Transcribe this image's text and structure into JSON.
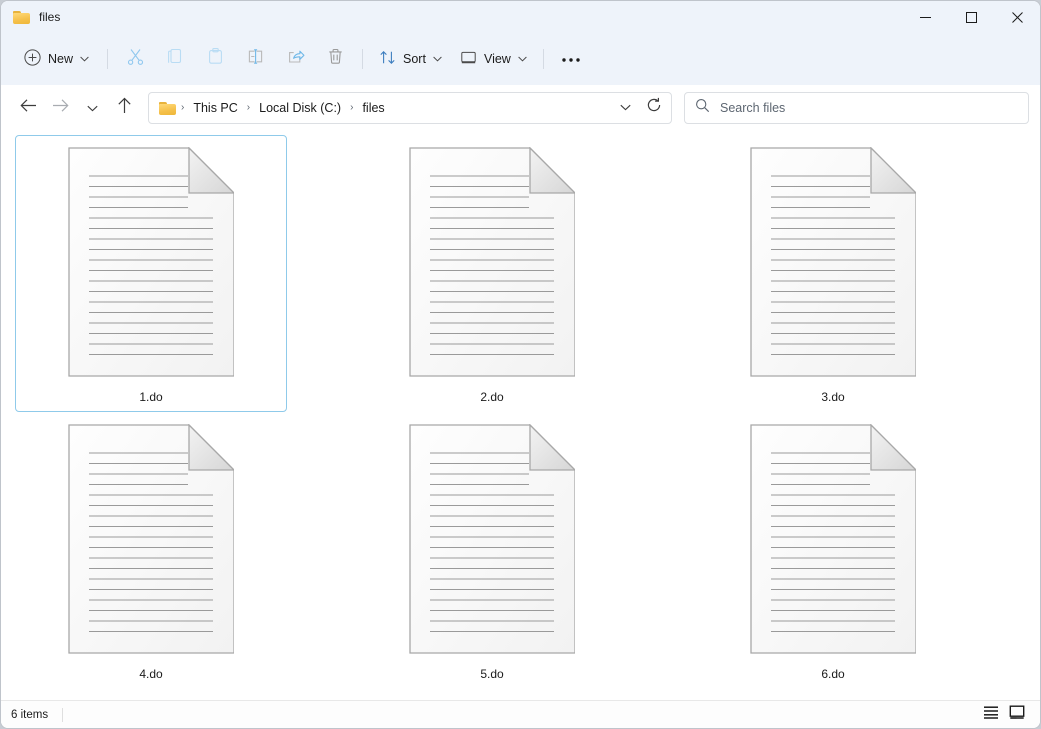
{
  "window": {
    "tab_title": "files",
    "folder_icon": "folder-icon",
    "minimize_label": "Minimize",
    "maximize_label": "Maximize",
    "close_label": "Close"
  },
  "toolbar": {
    "new_label": "New",
    "new_icon": "plus-circle-icon",
    "cut_icon": "scissors-icon",
    "copy_icon": "copy-icon",
    "paste_icon": "paste-icon",
    "rename_icon": "rename-icon",
    "share_icon": "share-icon",
    "delete_icon": "trash-icon",
    "sort_label": "Sort",
    "sort_icon": "sort-arrows-icon",
    "view_label": "View",
    "view_icon": "monitor-icon",
    "more_label": "See more",
    "more_icon": "ellipsis-icon",
    "chevron": "⌄"
  },
  "nav": {
    "back_icon": "back-arrow-icon",
    "forward_icon": "forward-arrow-icon",
    "recent_icon": "chevron-down-icon",
    "up_icon": "up-arrow-icon",
    "address_chevron_icon": "chevron-down-icon",
    "refresh_icon": "refresh-icon",
    "breadcrumb_icon": "folder-icon",
    "breadcrumbs": [
      {
        "label": "This PC"
      },
      {
        "label": "Local Disk (C:)"
      },
      {
        "label": "files"
      }
    ],
    "separator": "›"
  },
  "search": {
    "placeholder": "Search files",
    "icon": "search-icon"
  },
  "files": [
    {
      "name": "1.do",
      "icon": "document-icon",
      "selected": true
    },
    {
      "name": "2.do",
      "icon": "document-icon",
      "selected": false
    },
    {
      "name": "3.do",
      "icon": "document-icon",
      "selected": false
    },
    {
      "name": "4.do",
      "icon": "document-icon",
      "selected": false
    },
    {
      "name": "5.do",
      "icon": "document-icon",
      "selected": false
    },
    {
      "name": "6.do",
      "icon": "document-icon",
      "selected": false
    }
  ],
  "statusbar": {
    "item_count": "6 items",
    "details_view_icon": "details-view-icon",
    "large_icons_view_icon": "large-icons-view-icon"
  },
  "colors": {
    "selection_border": "#8fcaea",
    "toolbar_bg": "#eef3fa",
    "accent_icon": "#90c8ef",
    "folder_yellow": "#f5c04a"
  }
}
